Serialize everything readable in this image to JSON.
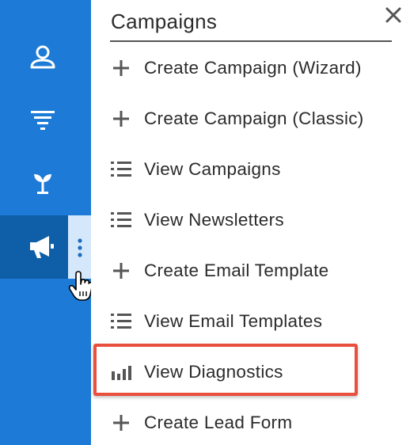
{
  "sidebar": {
    "items": [
      {
        "icon": "user-icon"
      },
      {
        "icon": "filter-icon"
      },
      {
        "icon": "plant-icon"
      },
      {
        "icon": "megaphone-icon",
        "active": true
      }
    ],
    "kebab_icon": "more-vertical-icon",
    "colors": {
      "bg": "#1d7ad6",
      "active": "#0f5ea8",
      "kebab_bg": "#d5e8fb"
    }
  },
  "panel": {
    "title": "Campaigns",
    "close_icon": "close-icon",
    "items": [
      {
        "icon": "plus-icon",
        "label": "Create Campaign (Wizard)"
      },
      {
        "icon": "plus-icon",
        "label": "Create Campaign (Classic)"
      },
      {
        "icon": "list-icon",
        "label": "View Campaigns"
      },
      {
        "icon": "list-icon",
        "label": "View Newsletters"
      },
      {
        "icon": "plus-icon",
        "label": "Create Email Template"
      },
      {
        "icon": "list-icon",
        "label": "View Email Templates"
      },
      {
        "icon": "bar-chart-icon",
        "label": "View Diagnostics",
        "highlighted": true
      },
      {
        "icon": "plus-icon",
        "label": "Create Lead Form"
      }
    ],
    "highlight_color": "#e8503d"
  }
}
